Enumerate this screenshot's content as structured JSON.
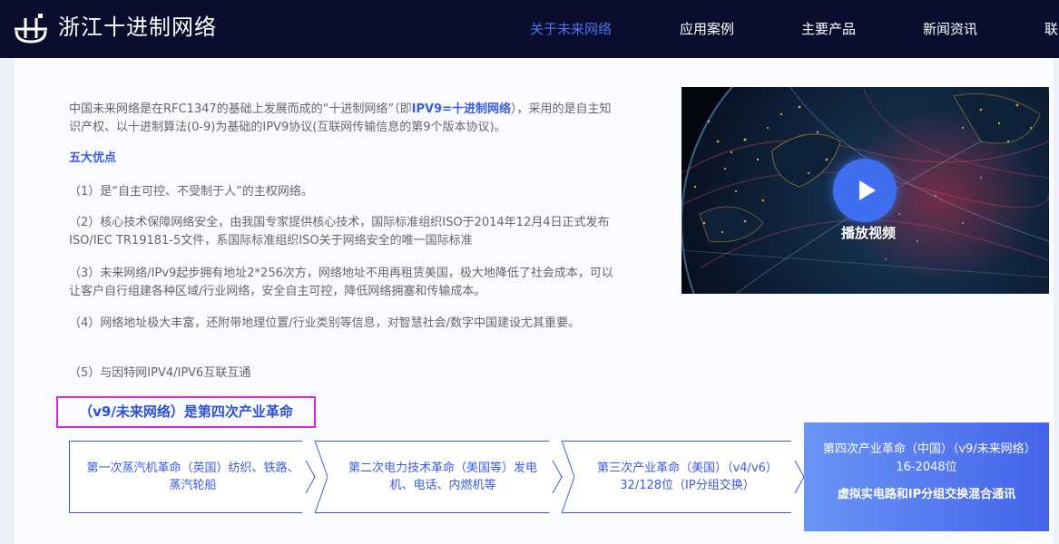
{
  "header": {
    "brand": "浙江十进制网络",
    "nav": [
      "关于未来网络",
      "应用案例",
      "主要产品",
      "新闻资讯",
      "联"
    ]
  },
  "intro": {
    "p1_a": "中国未来网络是在RFC1347的基础上发展而成的“十进制网络”（即",
    "p1_b": "IPV9=十进制网络",
    "p1_c": "），采用的是自主知识产权、以十进制算法(0-9)为基础的IPV9协议(互联网传输信息的第9个版本协议)。"
  },
  "advantages": {
    "title": "五大优点",
    "items": [
      "（1）是“自主可控、不受制于人”的主权网络。",
      "（2）核心技术保障网络安全，由我国专家提供核心技术，国际标准组织ISO于2014年12月4日正式发布ISO/IEC TR19181-5文件，系国际标准组织ISO关于网络安全的唯一国际标准",
      "（3）未来网络/IPv9起步拥有地址2*256次方，网络地址不用再租赁美国，极大地降低了社会成本，可以让客户自行组建各种区域/行业网络，安全自主可控，降低网络拥塞和传输成本。",
      "（4）网络地址极大丰富，还附带地理位置/行业类别等信息，对智慧社会/数字中国建设尤其重要。",
      "（5）与因特网IPV4/IPV6互联互通"
    ]
  },
  "video": {
    "play_label": "播放视频"
  },
  "revolution": {
    "heading": "（v9/未来网络）是第四次产业革命",
    "steps": [
      "第一次蒸汽机革命（英国）纺织、铁路、蒸汽轮船",
      "第二次电力技术革命（美国等）发电机、电话、内燃机等",
      "第三次产业革命（美国）（v4/v6）32/128位（IP分组交换）"
    ],
    "final_line1": "第四次产业革命（中国）（v9/未来网络）16-2048位",
    "final_line2": "虚拟实电路和IP分组交换混合通讯"
  }
}
